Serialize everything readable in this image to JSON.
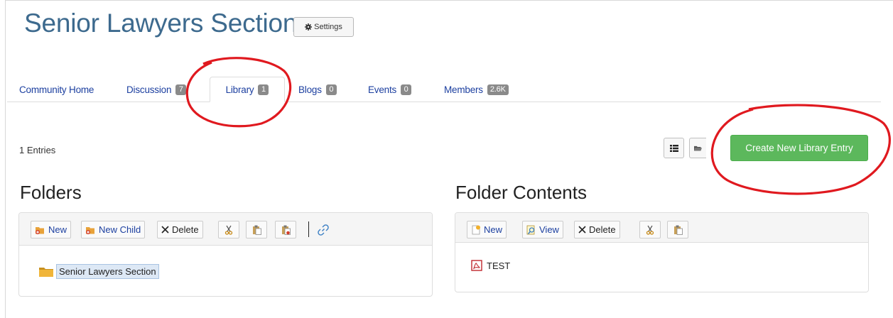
{
  "header": {
    "title": "Senior Lawyers Section",
    "settings_label": "Settings"
  },
  "tabs": [
    {
      "label": "Community Home",
      "badge": null
    },
    {
      "label": "Discussion",
      "badge": "7"
    },
    {
      "label": "Library",
      "badge": "1",
      "active": true
    },
    {
      "label": "Blogs",
      "badge": "0"
    },
    {
      "label": "Events",
      "badge": "0"
    },
    {
      "label": "Members",
      "badge": "2.6K"
    }
  ],
  "library": {
    "entries_text": "1 Entries",
    "create_button": "Create New Library Entry",
    "view_icons": [
      "list-view-icon",
      "folder-view-icon"
    ]
  },
  "folders": {
    "heading": "Folders",
    "toolbar": {
      "new": "New",
      "new_child": "New Child",
      "delete": "Delete"
    },
    "items": [
      {
        "label": "Senior Lawyers Section",
        "icon": "folder-icon",
        "selected": true
      }
    ]
  },
  "folder_contents": {
    "heading": "Folder Contents",
    "toolbar": {
      "new": "New",
      "view": "View",
      "delete": "Delete"
    },
    "items": [
      {
        "label": "TEST",
        "icon": "pdf-icon"
      }
    ]
  },
  "annotation_color": "#e0191f"
}
